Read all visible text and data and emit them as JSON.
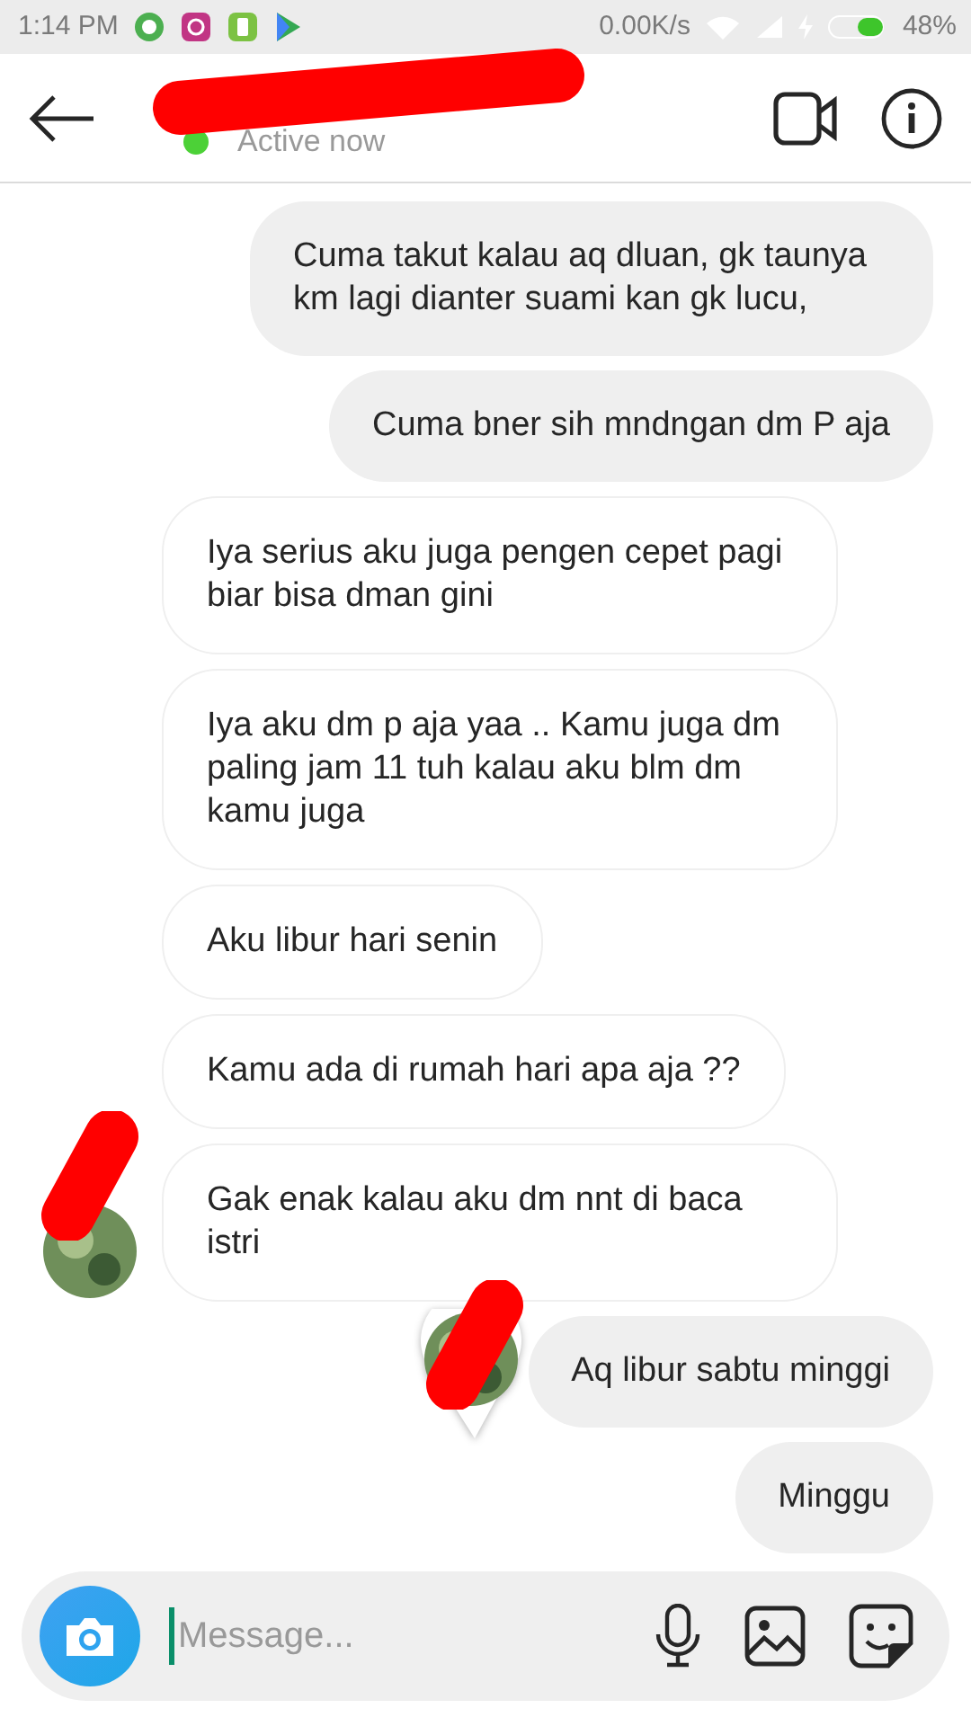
{
  "status_bar": {
    "time": "1:14 PM",
    "net_speed": "0.00K/s",
    "battery": "48%"
  },
  "header": {
    "name_redacted": true,
    "active_status": "Active now",
    "online": true
  },
  "messages": [
    {
      "text": "Cuma takut kalau aq dluan, gk taunya km lagi dianter suami kan gk lucu,",
      "kind": "sent",
      "avatar": false,
      "seen": false
    },
    {
      "text": "Cuma bner sih mndngan dm P aja",
      "kind": "sent",
      "avatar": false,
      "seen": false
    },
    {
      "text": "Iya serius aku juga pengen cepet pagi biar bisa dman gini",
      "kind": "received",
      "avatar": false,
      "seen": false
    },
    {
      "text": "Iya aku dm p aja yaa .. Kamu juga dm paling jam 11 tuh kalau aku blm dm kamu juga",
      "kind": "received",
      "avatar": false,
      "seen": false
    },
    {
      "text": "Aku libur hari senin",
      "kind": "received",
      "avatar": false,
      "seen": false
    },
    {
      "text": "Kamu ada di rumah hari apa aja ??",
      "kind": "received",
      "avatar": false,
      "seen": false
    },
    {
      "text": "Gak enak kalau aku dm nnt di baca istri",
      "kind": "received",
      "avatar": true,
      "seen": false
    },
    {
      "text": "Aq libur sabtu minggi",
      "kind": "sent",
      "avatar": false,
      "seen": true
    },
    {
      "text": "Minggu",
      "kind": "sent",
      "avatar": false,
      "seen": false
    }
  ],
  "composer": {
    "placeholder": "Message..."
  }
}
